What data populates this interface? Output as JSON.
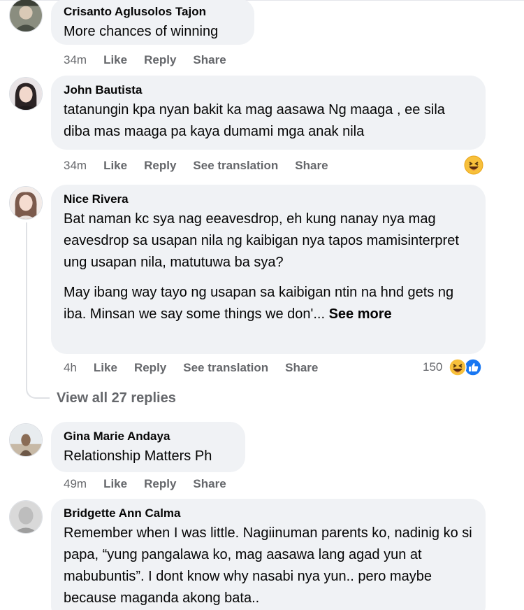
{
  "comments": [
    {
      "author": "Crisanto Aglusolos Tajon",
      "text": [
        "More chances of winning"
      ],
      "time": "34m",
      "actions": [
        "Like",
        "Reply",
        "Share"
      ]
    },
    {
      "author": "John Bautista",
      "text": [
        "tatanungin kpa nyan bakit ka mag aasawa Ng maaga , ee sila diba mas maaga pa kaya dumami mga anak nila"
      ],
      "time": "34m",
      "actions": [
        "Like",
        "Reply",
        "See translation",
        "Share"
      ],
      "reaction": "haha-emoji"
    },
    {
      "author": "Nice Rivera",
      "text": [
        "Bat naman kc sya nag eeavesdrop, eh kung nanay nya mag eavesdrop sa usapan nila ng kaibigan nya tapos mamisinterpret ung usapan nila, matutuwa ba sya?",
        "May ibang way tayo ng usapan sa kaibigan ntin na hnd gets ng iba. Minsan we say some things we don'..."
      ],
      "see_more": "See more",
      "time": "4h",
      "actions": [
        "Like",
        "Reply",
        "See translation",
        "Share"
      ],
      "reaction_count": "150",
      "reactions": [
        "haha-emoji",
        "like-emoji"
      ]
    },
    {
      "author": "Gina Marie Andaya",
      "text": [
        "Relationship Matters Ph"
      ],
      "time": "49m",
      "actions": [
        "Like",
        "Reply",
        "Share"
      ]
    },
    {
      "author": "Bridgette Ann Calma",
      "text": [
        "Remember when I was little. Nagiinuman parents ko, nadinig ko si papa, “yung pangalawa ko, mag aasawa lang agad yun at mabubuntis”. I dont know why nasabi nya yun.. pero maybe because maganda akong bata.."
      ]
    }
  ],
  "view_replies": "View all 27 replies",
  "colors": {
    "bubble": "#f0f2f5",
    "meta_text": "#65676b",
    "body_text": "#050505",
    "like_blue": "#1877f2",
    "haha_yellow": "#f7c03b"
  }
}
